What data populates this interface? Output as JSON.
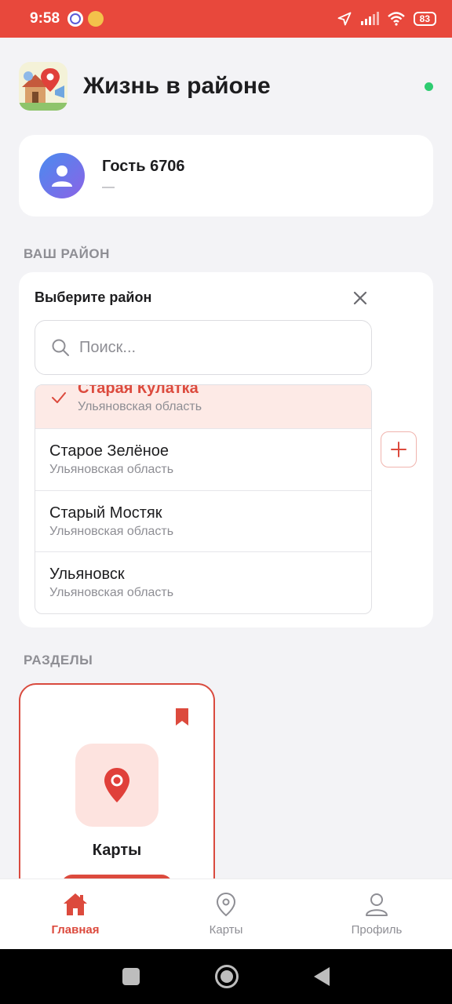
{
  "status_bar": {
    "time": "9:58",
    "battery": "83"
  },
  "header": {
    "title": "Жизнь в районе"
  },
  "user": {
    "name": "Гость 6706",
    "subtitle": "—"
  },
  "district_section": {
    "label": "ВАШ РАЙОН",
    "picker_title": "Выберите район",
    "search_placeholder": "Поиск...",
    "items": [
      {
        "name": "Старая Кулатка",
        "region": "Ульяновская область",
        "selected": true
      },
      {
        "name": "Старое Зелёное",
        "region": "Ульяновская область"
      },
      {
        "name": "Старый Мостяк",
        "region": "Ульяновская область"
      },
      {
        "name": "Ульяновск",
        "region": "Ульяновская область"
      }
    ]
  },
  "sections": {
    "label": "РАЗДЕЛЫ",
    "items": [
      {
        "title": "Карты"
      }
    ]
  },
  "bottom_nav": {
    "items": [
      {
        "label": "Главная",
        "icon": "home-icon",
        "active": true
      },
      {
        "label": "Карты",
        "icon": "map-pin-icon"
      },
      {
        "label": "Профиль",
        "icon": "user-icon"
      }
    ]
  },
  "colors": {
    "accent": "#dc4a3d",
    "status_bar": "#e8483c",
    "online": "#2ecc71"
  }
}
